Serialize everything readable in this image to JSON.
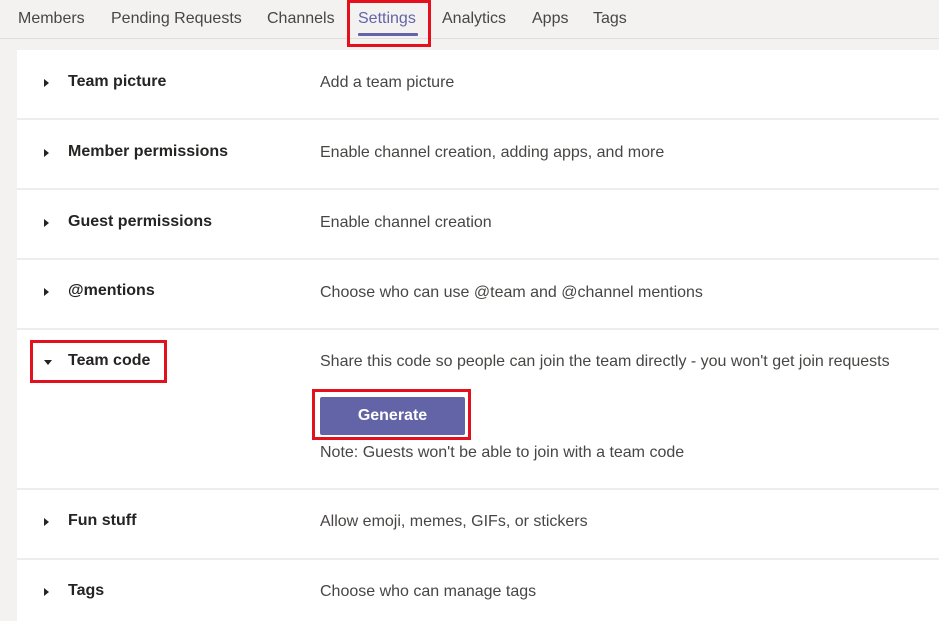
{
  "tabs": [
    {
      "label": "Members"
    },
    {
      "label": "Pending Requests"
    },
    {
      "label": "Channels"
    },
    {
      "label": "Settings",
      "active": true
    },
    {
      "label": "Analytics"
    },
    {
      "label": "Apps"
    },
    {
      "label": "Tags"
    }
  ],
  "settings": [
    {
      "title": "Team picture",
      "description": "Add a team picture",
      "expanded": false
    },
    {
      "title": "Member permissions",
      "description": "Enable channel creation, adding apps, and more",
      "expanded": false
    },
    {
      "title": "Guest permissions",
      "description": "Enable channel creation",
      "expanded": false
    },
    {
      "title": "@mentions",
      "description": "Choose who can use @team and @channel mentions",
      "expanded": false
    },
    {
      "title": "Team code",
      "description": "Share this code so people can join the team directly - you won't get join requests",
      "expanded": true,
      "button_label": "Generate",
      "note": "Note: Guests won't be able to join with a team code"
    },
    {
      "title": "Fun stuff",
      "description": "Allow emoji, memes, GIFs, or stickers",
      "expanded": false
    },
    {
      "title": "Tags",
      "description": "Choose who can manage tags",
      "expanded": false
    }
  ],
  "colors": {
    "accent": "#6264a7",
    "highlight": "#e3101d",
    "background": "#f3f2f1",
    "panel": "#ffffff"
  },
  "icons": {
    "collapsed": "caret-right-icon",
    "expanded": "caret-down-icon"
  }
}
